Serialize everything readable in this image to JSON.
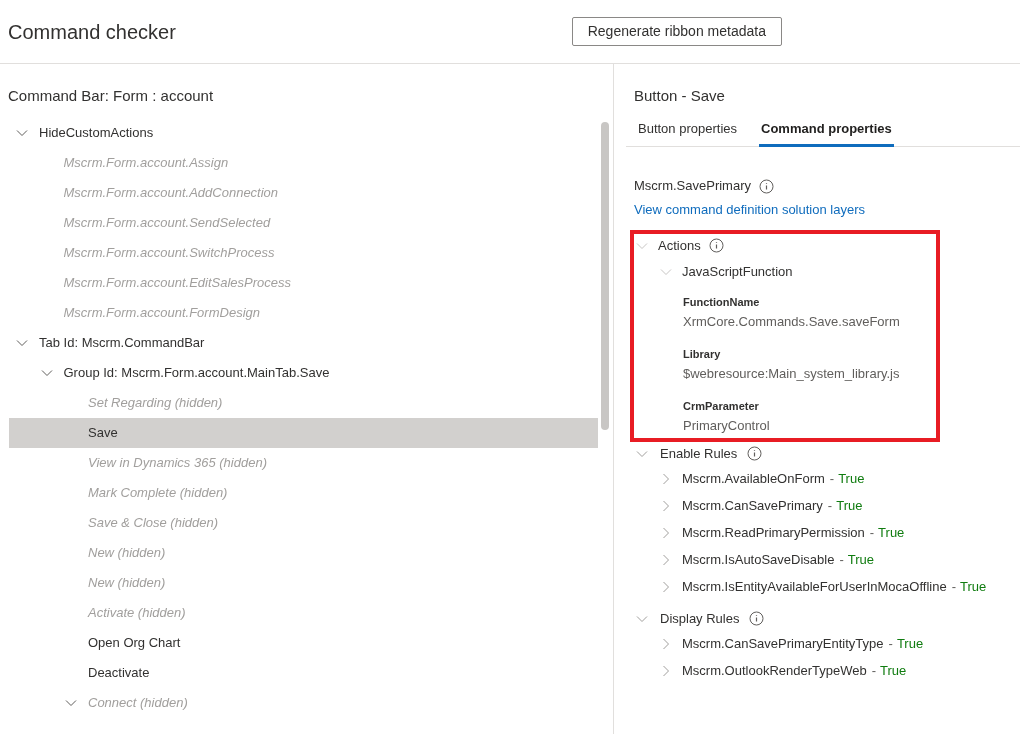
{
  "header": {
    "title": "Command checker",
    "button": "Regenerate ribbon metadata"
  },
  "left": {
    "title": "Command Bar: Form : account",
    "tree": [
      {
        "label": "HideCustomActions",
        "hidden": false,
        "selected": false,
        "expanded": true,
        "children": [
          {
            "label": "Mscrm.Form.account.Assign",
            "hidden": true,
            "selected": false
          },
          {
            "label": "Mscrm.Form.account.AddConnection",
            "hidden": true,
            "selected": false
          },
          {
            "label": "Mscrm.Form.account.SendSelected",
            "hidden": true,
            "selected": false
          },
          {
            "label": "Mscrm.Form.account.SwitchProcess",
            "hidden": true,
            "selected": false
          },
          {
            "label": "Mscrm.Form.account.EditSalesProcess",
            "hidden": true,
            "selected": false
          },
          {
            "label": "Mscrm.Form.account.FormDesign",
            "hidden": true,
            "selected": false
          }
        ]
      },
      {
        "label": "Tab Id: Mscrm.CommandBar",
        "hidden": false,
        "selected": false,
        "expanded": true,
        "children": [
          {
            "label": "Group Id: Mscrm.Form.account.MainTab.Save",
            "hidden": false,
            "selected": false,
            "expanded": true,
            "children": [
              {
                "label": "Set Regarding (hidden)",
                "hidden": true,
                "selected": false
              },
              {
                "label": "Save",
                "hidden": false,
                "selected": true
              },
              {
                "label": "View in Dynamics 365 (hidden)",
                "hidden": true,
                "selected": false
              },
              {
                "label": "Mark Complete (hidden)",
                "hidden": true,
                "selected": false
              },
              {
                "label": "Save & Close (hidden)",
                "hidden": true,
                "selected": false
              },
              {
                "label": "New (hidden)",
                "hidden": true,
                "selected": false
              },
              {
                "label": "New (hidden)",
                "hidden": true,
                "selected": false
              },
              {
                "label": "Activate (hidden)",
                "hidden": true,
                "selected": false
              },
              {
                "label": "Open Org Chart",
                "hidden": false,
                "selected": false
              },
              {
                "label": "Deactivate",
                "hidden": false,
                "selected": false
              },
              {
                "label": "Connect (hidden)",
                "hidden": true,
                "selected": false,
                "expanded": true
              }
            ]
          }
        ]
      }
    ]
  },
  "right": {
    "title": "Button - Save",
    "tabs": [
      {
        "label": "Button properties",
        "selected": false
      },
      {
        "label": "Command properties",
        "selected": true
      }
    ],
    "command": "Mscrm.SavePrimary",
    "link": "View command definition solution layers",
    "actions": {
      "label": "Actions",
      "expanded": true,
      "highlighted": true,
      "items": [
        {
          "label": "JavaScriptFunction",
          "expanded": true,
          "params": [
            {
              "name": "FunctionName",
              "value": "XrmCore.Commands.Save.saveForm"
            },
            {
              "name": "Library",
              "value": "$webresource:Main_system_library.js"
            },
            {
              "name": "CrmParameter",
              "value": "PrimaryControl"
            }
          ]
        }
      ]
    },
    "rule_sections": [
      {
        "label": "Enable Rules",
        "expanded": true,
        "rules": [
          {
            "name": "Mscrm.AvailableOnForm",
            "separator": "-",
            "result": "True",
            "expanded": false
          },
          {
            "name": "Mscrm.CanSavePrimary",
            "separator": "-",
            "result": "True",
            "expanded": false
          },
          {
            "name": "Mscrm.ReadPrimaryPermission",
            "separator": "-",
            "result": "True",
            "expanded": false
          },
          {
            "name": "Mscrm.IsAutoSaveDisable",
            "separator": "-",
            "result": "True",
            "expanded": false
          },
          {
            "name": "Mscrm.IsEntityAvailableForUserInMocaOffline",
            "separator": "-",
            "result": "True",
            "expanded": false
          }
        ]
      },
      {
        "label": "Display Rules",
        "expanded": true,
        "rules": [
          {
            "name": "Mscrm.CanSavePrimaryEntityType",
            "separator": "-",
            "result": "True",
            "expanded": false
          },
          {
            "name": "Mscrm.OutlookRenderTypeWeb",
            "separator": "-",
            "result": "True",
            "expanded": false
          }
        ]
      }
    ]
  }
}
